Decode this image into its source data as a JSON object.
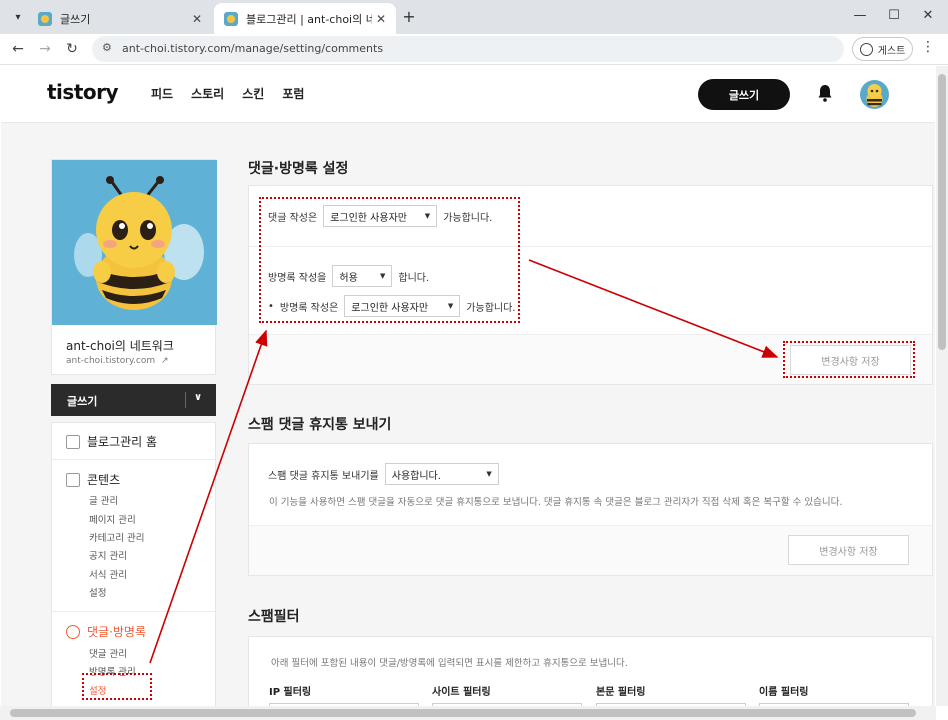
{
  "browser": {
    "tabs": [
      {
        "title": "글쓰기",
        "active": false
      },
      {
        "title": "블로그관리 | ant-choi의 네트워크",
        "active": true
      }
    ],
    "url": "ant-choi.tistory.com/manage/setting/comments",
    "guest_label": "게스트"
  },
  "header": {
    "logo": "tistory",
    "nav": [
      "피드",
      "스토리",
      "스킨",
      "포럼"
    ],
    "write_label": "글쓰기"
  },
  "sidebar": {
    "blog_name": "ant-choi의 네트워크",
    "blog_url": "ant-choi.tistory.com",
    "write_label": "글쓰기",
    "home_label": "블로그관리 홈",
    "contents": {
      "label": "콘텐츠",
      "items": [
        "글 관리",
        "페이지 관리",
        "카테고리 관리",
        "공지 관리",
        "서식 관리",
        "설정"
      ]
    },
    "comments": {
      "label": "댓글·방명록",
      "items": [
        "댓글 관리",
        "방명록 관리",
        "설정"
      ]
    }
  },
  "main": {
    "comment_section": {
      "title": "댓글·방명록 설정",
      "comment_prefix": "댓글 작성은",
      "comment_value": "로그인한 사용자만",
      "comment_suffix": "가능합니다.",
      "guestbook_prefix": "방명록 작성을",
      "guestbook_value": "허용",
      "guestbook_suffix": "합니다.",
      "guestbook_sub_prefix": "방명록 작성은",
      "guestbook_sub_value": "로그인한 사용자만",
      "guestbook_sub_suffix": "가능합니다.",
      "save_label": "변경사항 저장"
    },
    "spam_section": {
      "title": "스팸 댓글 휴지통 보내기",
      "prefix": "스팸 댓글 휴지통 보내기를",
      "value": "사용합니다.",
      "description": "이 기능을 사용하면 스팸 댓글을 자동으로 댓글 휴지통으로 보냅니다. 댓글 휴지통 속 댓글은 블로그 관리자가 직접 삭제 혹은 복구할 수 있습니다.",
      "save_label": "변경사항 저장"
    },
    "filter_section": {
      "title": "스팸필터",
      "description": "아래 필터에 포함된 내용이 댓글/방명록에 입력되면 표시를 제한하고 휴지통으로 보냅니다.",
      "filters": [
        "IP 필터링",
        "사이트 필터링",
        "본문 필터링",
        "이름 필터링"
      ]
    }
  },
  "colors": {
    "accent": "#f25a34",
    "annotation": "#cc0000",
    "dark_button": "#111111"
  }
}
